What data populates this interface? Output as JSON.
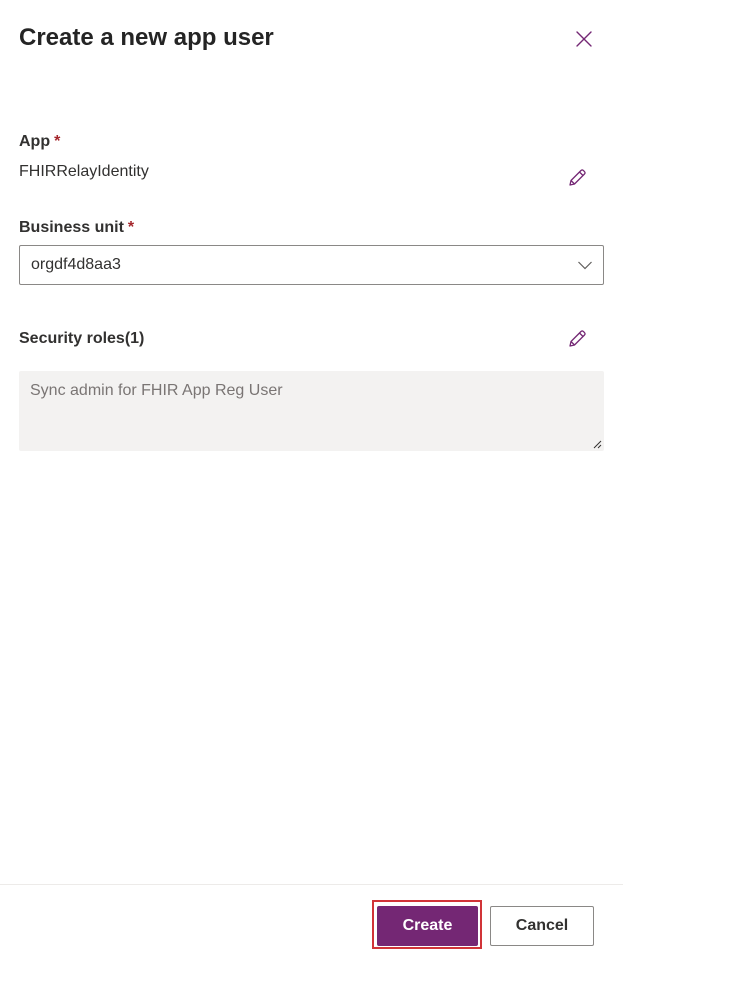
{
  "panel": {
    "title": "Create a new app user",
    "close_icon": "close-icon"
  },
  "app_field": {
    "label": "App",
    "required_mark": "*",
    "value": "FHIRRelayIdentity",
    "edit_icon": "pencil-icon"
  },
  "business_unit": {
    "label": "Business unit",
    "required_mark": "*",
    "selected": "orgdf4d8aa3",
    "chevron_icon": "chevron-down-icon"
  },
  "security_roles": {
    "label": "Security roles(1)",
    "edit_icon": "pencil-icon",
    "text": "Sync admin for FHIR App Reg User"
  },
  "footer": {
    "create_label": "Create",
    "cancel_label": "Cancel"
  },
  "colors": {
    "accent": "#742774",
    "required": "#a4262c",
    "highlight_outline": "#d13438",
    "readonly_bg": "#f3f2f1"
  }
}
